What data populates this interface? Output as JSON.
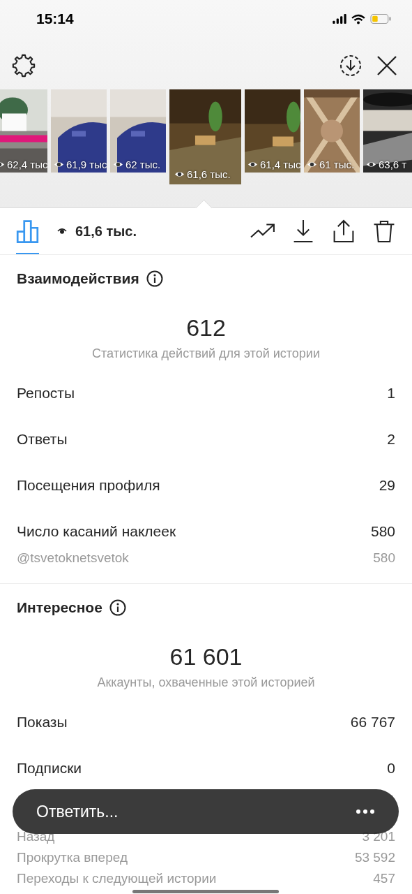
{
  "status_bar": {
    "time": "15:14"
  },
  "stories": [
    {
      "views": "62,4 тыс",
      "selected": false,
      "kind": "plant"
    },
    {
      "views": "61,9 тыс",
      "selected": false,
      "kind": "floor"
    },
    {
      "views": "62 тыс.",
      "selected": false,
      "kind": "floor"
    },
    {
      "views": "61,6 тыс.",
      "selected": true,
      "kind": "wood"
    },
    {
      "views": "61,4 тыс",
      "selected": false,
      "kind": "wood"
    },
    {
      "views": "61 тыс.",
      "selected": false,
      "kind": "carpet"
    },
    {
      "views": "63,6 т",
      "selected": false,
      "kind": "dark"
    }
  ],
  "toolbar": {
    "views": "61,6 тыс."
  },
  "sections": [
    {
      "title": "Взаимодействия",
      "total": "612",
      "caption": "Статистика действий для этой истории",
      "rows": [
        {
          "label": "Репосты",
          "value": "1",
          "kind": "main"
        },
        {
          "label": "Ответы",
          "value": "2",
          "kind": "main"
        },
        {
          "label": "Посещения профиля",
          "value": "29",
          "kind": "main"
        },
        {
          "label": "Число касаний наклеек",
          "value": "580",
          "kind": "main"
        },
        {
          "label": "@tsvetoknetsvetok",
          "value": "580",
          "kind": "sub"
        }
      ]
    },
    {
      "title": "Интересное",
      "total": "61 601",
      "caption": "Аккаунты, охваченные этой историей",
      "rows": [
        {
          "label": "Показы",
          "value": "66 767",
          "kind": "main"
        },
        {
          "label": "Подписки",
          "value": "0",
          "kind": "main"
        },
        {
          "label": "Назад",
          "value": "3 201",
          "kind": "sub"
        },
        {
          "label": "Прокрутка вперед",
          "value": "53 592",
          "kind": "sub"
        },
        {
          "label": "Переходы к следующей истории",
          "value": "457",
          "kind": "sub"
        }
      ]
    }
  ],
  "reply_bar": {
    "placeholder": "Ответить..."
  }
}
